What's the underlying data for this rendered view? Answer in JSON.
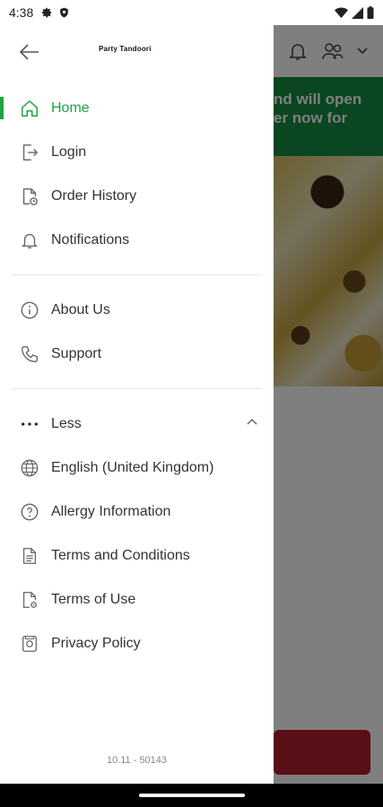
{
  "status_bar": {
    "time": "4:38"
  },
  "drawer": {
    "brand": "Party Tandoori",
    "primary_items": [
      {
        "label": "Home",
        "icon": "home-icon",
        "active": true
      },
      {
        "label": "Login",
        "icon": "login-icon",
        "active": false
      },
      {
        "label": "Order History",
        "icon": "order-history-icon",
        "active": false
      },
      {
        "label": "Notifications",
        "icon": "bell-icon",
        "active": false
      }
    ],
    "secondary_items": [
      {
        "label": "About Us",
        "icon": "info-icon"
      },
      {
        "label": "Support",
        "icon": "phone-icon"
      }
    ],
    "less_label": "Less",
    "tertiary_items": [
      {
        "label": "English (United Kingdom)",
        "icon": "globe-icon"
      },
      {
        "label": "Allergy Information",
        "icon": "question-icon"
      },
      {
        "label": "Terms and Conditions",
        "icon": "document-icon"
      },
      {
        "label": "Terms of Use",
        "icon": "document-settings-icon"
      },
      {
        "label": "Privacy Policy",
        "icon": "privacy-icon"
      }
    ],
    "version": "10.11 - 50143"
  },
  "background": {
    "banner_line1": "nd will open",
    "banner_line2": "er now for"
  },
  "colors": {
    "accent": "#1da444",
    "banner": "#138c43",
    "cta": "#b31f2a"
  }
}
